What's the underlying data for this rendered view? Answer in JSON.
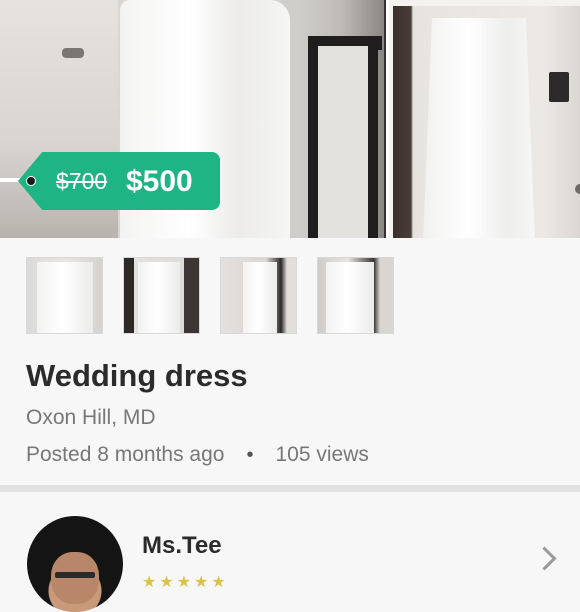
{
  "listing": {
    "price_original": "$700",
    "price_current": "$500",
    "title": "Wedding dress",
    "location": "Oxon Hill, MD",
    "posted": "Posted 8 months ago",
    "separator": "•",
    "views": "105 views",
    "thumbnail_count": 4
  },
  "seller": {
    "name": "Ms.Tee",
    "stars": "★★★★★"
  },
  "colors": {
    "price_tag": "#1eb483",
    "title_text": "#2b2b2b",
    "secondary_text": "#777777",
    "divider": "#e2e2e2",
    "star": "#d9c24a"
  },
  "icons": {
    "chevron": "chevron-right-icon",
    "separator": "dot-separator"
  }
}
